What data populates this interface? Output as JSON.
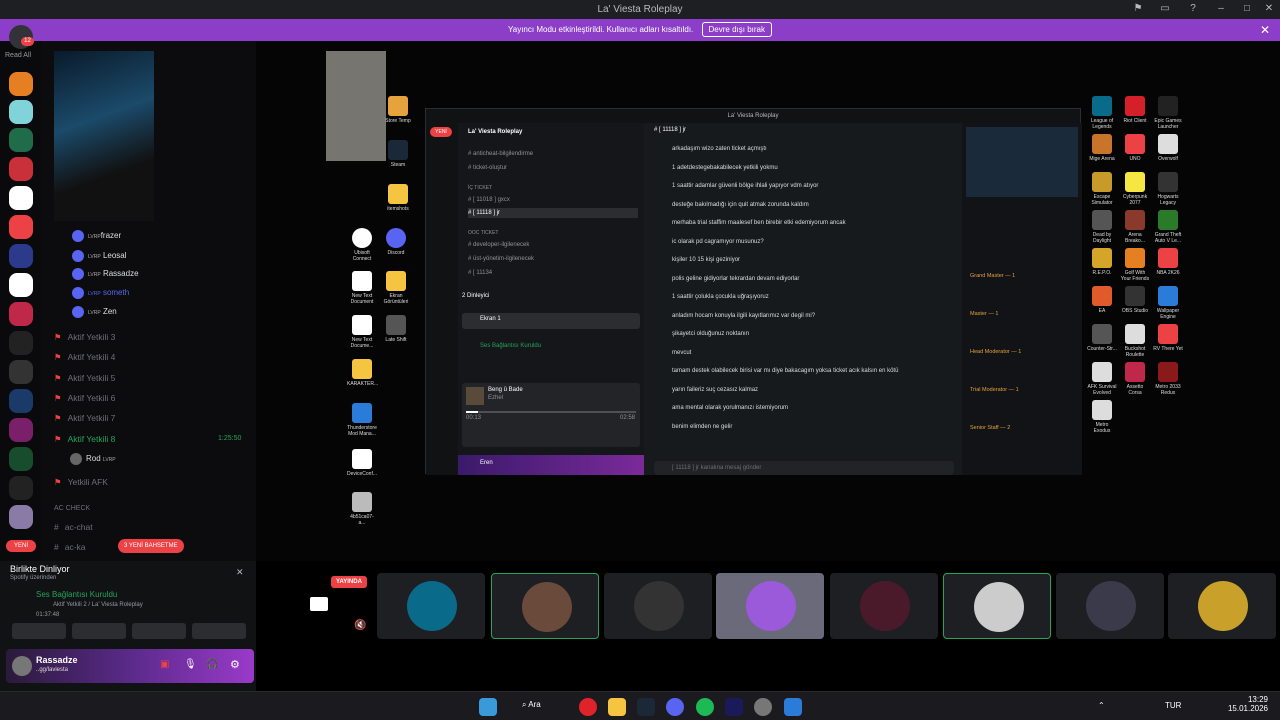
{
  "window": {
    "title": "La' Viesta Roleplay"
  },
  "banner": {
    "text": "Yayıncı Modu etkinleştirildi. Kullanıcı adları kısaltıldı.",
    "button": "Devre dışı bırak"
  },
  "guilds": {
    "read_all": "Read All",
    "badge": "12",
    "new_label": "YENİ"
  },
  "voice": {
    "users": [
      {
        "name": "frazer"
      },
      {
        "name": "Leosal"
      },
      {
        "name": "Rassadze"
      },
      {
        "name": "someth"
      },
      {
        "name": "Zen"
      }
    ],
    "tag": "LVRP",
    "channels": [
      "Aktif Yetkili 3",
      "Aktif Yetkili 4",
      "Aktif Yetkili 5",
      "Aktif Yetkili 6",
      "Aktif Yetkili 7"
    ],
    "active_channel": "Aktif Yetkili 8",
    "active_time": "1:25:50",
    "rod": "Rod",
    "afk": "Yetkili AFK",
    "category": "AC CHECK",
    "text_channel": "ac-chat",
    "text_channel2": "ac-ka",
    "new_messages": "3 YENİ BAHSETME"
  },
  "panel": {
    "listening_title": "Birlikte Dinliyor",
    "listening_sub": "Spotify üzerinden",
    "connection": "Ses Bağlantısı Kuruldu",
    "connection_sub": "Aktif Yetkili 2 / La' Viesta Roleplay",
    "timer": "01:37:48",
    "user": "Rassadze",
    "user_sub": "..gg/laviesta"
  },
  "stage": {
    "live": "YAYINDA"
  },
  "desktop_left": [
    "Store Temp",
    "Steam",
    "itemshots",
    "Ubisoft Connect",
    "Discord",
    "New Text Document",
    "Ekran Görüntüleri",
    "New Text Docume...",
    "Late Shift",
    "KARAKTER...",
    "Thunderstore Mod Mana...",
    "DeviceConf...",
    "4b51ca07-a..."
  ],
  "desktop_right": [
    "League of Legends",
    "Riot Client",
    "Epic Games Launcher",
    "Mige Arena",
    "UNO",
    "Overwolf",
    "Escape Simulator",
    "Cyberpunk 2077",
    "Hogwarts Legacy",
    "Dead by Daylight",
    "Arena Breako...",
    "Grand Theft Auto V Le...",
    "R.E.P.O.",
    "Golf With Your Friends",
    "NBA 2K26",
    "EA",
    "OBS Studio",
    "Wallpaper Engine",
    "Counter-Str...",
    "Buckshot Roulette",
    "RV There Yet",
    "AFK Survival Evolved",
    "Assetto Corsa",
    "Metro 2033 Redux",
    "Metro Exodus"
  ],
  "inner": {
    "title": "La' Viesta Roleplay",
    "server": "La' Viesta Roleplay",
    "channels": [
      "anticheat-bilgilendirme",
      "ticket-oluştur",
      "İÇ TICKET",
      "[ 11018 ] gxcx",
      "[ 11118 ] jr",
      "OOC TICKET",
      "developer-ilgilenecek",
      "üst-yönetim-ilgilenecek",
      "[ 11134"
    ],
    "voice_count": "2 Dinleyici",
    "screen": "Ekran 1",
    "conn": "Ses Bağlantısı Kuruldu",
    "song": "Beng û Bade",
    "artist": "Ezhel",
    "t1": "00:13",
    "t2": "02:58",
    "user": "Eren",
    "channel_header": "[ 11118 ] jr",
    "messages": [
      "arkadaşım wizo zaten ticket açmıştı",
      "1 adetdestegebakabilecek yetkili yokmu",
      "1 saattir adamlar güvenli bölge ihlali yapıyor vdm atıyor",
      "desteğe bakılmadığı için quit atmak zorunda kaldım",
      "merhaba trial staffim maalesef ben birebir etki edemiyorum ancak",
      "ic olarak pd cagramıyor musunuz?",
      "kişiler 10 15 kişi geziniyor",
      "polis geline gidiyorlar tekrardan devam ediyorlar",
      "1 saattir çolukla çocukla uğraşıyoruz",
      "anladım hocam konuyla ilgili kayıtlarımız var degil mi?",
      "şikayetci olduğunuz noktanın",
      "mevcut",
      "tamam destek olabilecek birisi var mı diye bakacagım yoksa ticket acık kalsın en kötü",
      "yarın faileriz suç cezasız kalmaz",
      "ama mental olarak yorulmanızı istemiyorum",
      "benim elimden ne gelir"
    ],
    "input_placeholder": "[ 11118 ] jr kanalına mesaj gönder",
    "members": [
      "Grand Master — 1",
      "Master — 1",
      "Head Moderator — 1",
      "Trial Moderator — 1",
      "Senior Staff — 2"
    ]
  },
  "taskbar": {
    "search": "Ara",
    "lang": "TUR",
    "time": "13:29",
    "date": "15.01.2026"
  },
  "colors": {
    "accent": "#8c3ec9",
    "red": "#ed4245",
    "green": "#23a55a"
  }
}
